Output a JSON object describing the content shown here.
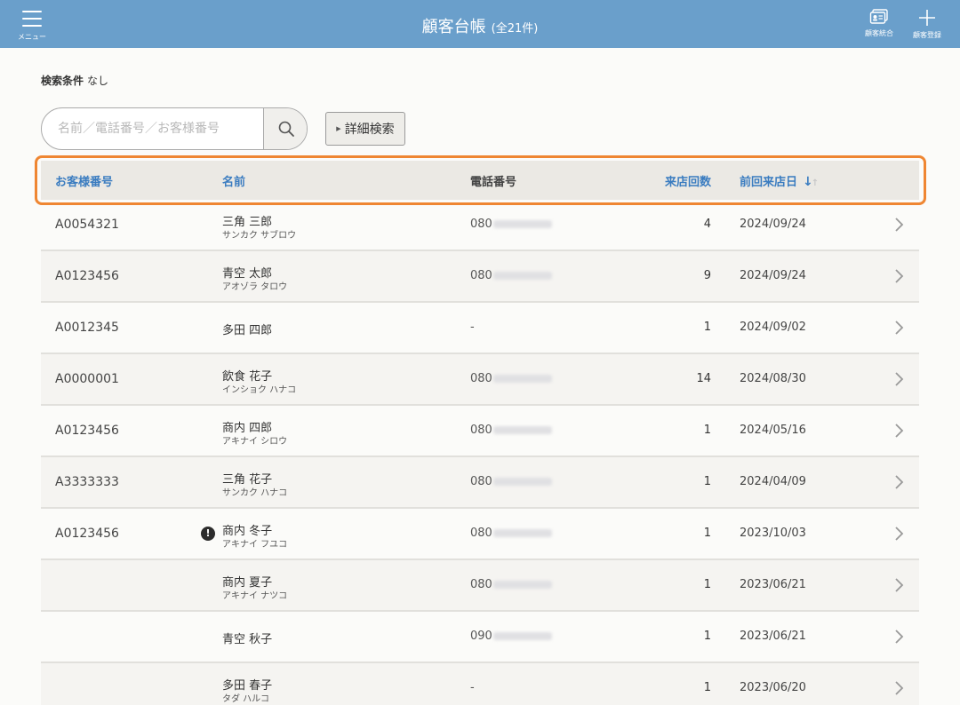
{
  "header": {
    "menu_label": "メニュー",
    "title": "顧客台帳",
    "count": "(全21件)",
    "merge_label": "顧客統合",
    "register_label": "顧客登録"
  },
  "search": {
    "condition_label": "検索条件",
    "condition_value": "なし",
    "placeholder": "名前／電話番号／お客様番号",
    "advanced_label": "詳細検索"
  },
  "table": {
    "columns": {
      "id": "お客様番号",
      "name": "名前",
      "phone": "電話番号",
      "visits": "来店回数",
      "last_visit": "前回来店日"
    },
    "rows": [
      {
        "id": "A0054321",
        "name": "三角 三郎",
        "kana": "サンカク サブロウ",
        "phone": "080",
        "visits": "4",
        "date": "2024/09/24"
      },
      {
        "id": "A0123456",
        "name": "青空 太郎",
        "kana": "アオゾラ タロウ",
        "phone": "080",
        "visits": "9",
        "date": "2024/09/24"
      },
      {
        "id": "A0012345",
        "name": "多田 四郎",
        "kana": "",
        "phone": "-",
        "visits": "1",
        "date": "2024/09/02"
      },
      {
        "id": "A0000001",
        "name": "飲食 花子",
        "kana": "インショク ハナコ",
        "phone": "080",
        "visits": "14",
        "date": "2024/08/30"
      },
      {
        "id": "A0123456",
        "name": "商内 四郎",
        "kana": "アキナイ シロウ",
        "phone": "080",
        "visits": "1",
        "date": "2024/05/16"
      },
      {
        "id": "A3333333",
        "name": "三角 花子",
        "kana": "サンカク ハナコ",
        "phone": "080",
        "visits": "1",
        "date": "2024/04/09"
      },
      {
        "id": "A0123456",
        "name": "商内 冬子",
        "kana": "アキナイ フユコ",
        "phone": "080",
        "visits": "1",
        "date": "2023/10/03",
        "warning": "!"
      },
      {
        "id": "",
        "name": "商内 夏子",
        "kana": "アキナイ ナツコ",
        "phone": "080",
        "visits": "1",
        "date": "2023/06/21"
      },
      {
        "id": "",
        "name": "青空 秋子",
        "kana": "",
        "phone": "090",
        "visits": "1",
        "date": "2023/06/21"
      },
      {
        "id": "",
        "name": "多田 春子",
        "kana": "タダ ハルコ",
        "phone": "-",
        "visits": "1",
        "date": "2023/06/20"
      }
    ]
  }
}
